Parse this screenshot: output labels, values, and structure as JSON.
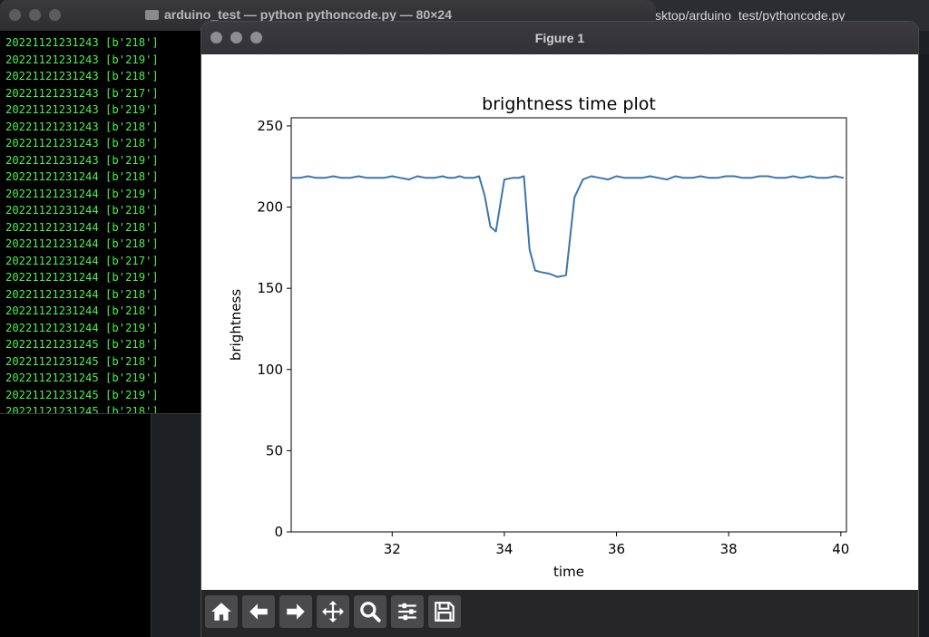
{
  "background_editor": {
    "path_text": "sktop/arduino_test/pythoncode.py"
  },
  "terminal": {
    "title": "arduino_test — python pythoncode.py — 80×24",
    "lines": [
      "20221121231243 [b'218']",
      "20221121231243 [b'219']",
      "20221121231243 [b'218']",
      "20221121231243 [b'217']",
      "20221121231243 [b'219']",
      "20221121231243 [b'218']",
      "20221121231243 [b'218']",
      "20221121231243 [b'219']",
      "20221121231244 [b'218']",
      "20221121231244 [b'219']",
      "20221121231244 [b'218']",
      "20221121231244 [b'218']",
      "20221121231244 [b'218']",
      "20221121231244 [b'217']",
      "20221121231244 [b'219']",
      "20221121231244 [b'218']",
      "20221121231244 [b'218']",
      "20221121231244 [b'219']",
      "20221121231245 [b'218']",
      "20221121231245 [b'218']",
      "20221121231245 [b'219']",
      "20221121231245 [b'219']",
      "20221121231245 [b'218']"
    ]
  },
  "figure": {
    "window_title": "Figure 1",
    "toolbar": [
      {
        "icon": "home-icon",
        "name": "home-button"
      },
      {
        "icon": "back-arrow-icon",
        "name": "back-button"
      },
      {
        "icon": "forward-arrow-icon",
        "name": "forward-button"
      },
      {
        "icon": "pan-move-icon",
        "name": "pan-button"
      },
      {
        "icon": "zoom-magnifier-icon",
        "name": "zoom-button"
      },
      {
        "icon": "configure-sliders-icon",
        "name": "configure-subplots-button"
      },
      {
        "icon": "save-floppy-icon",
        "name": "save-button"
      }
    ]
  },
  "chart_data": {
    "type": "line",
    "title": "brightness time plot",
    "xlabel": "time",
    "ylabel": "brightness",
    "xlim": [
      30.2,
      40.1
    ],
    "ylim": [
      0,
      255
    ],
    "xticks": [
      32,
      34,
      36,
      38,
      40
    ],
    "yticks": [
      0,
      50,
      100,
      150,
      200,
      250
    ],
    "grid": false,
    "line_color": "#3b75af",
    "series": [
      {
        "x": [
          30.2,
          30.35,
          30.5,
          30.65,
          30.8,
          30.95,
          31.1,
          31.25,
          31.4,
          31.55,
          31.7,
          31.85,
          32.0,
          32.15,
          32.3,
          32.45,
          32.6,
          32.75,
          32.9,
          33.0,
          33.1,
          33.2,
          33.3,
          33.45,
          33.55,
          33.65,
          33.75,
          33.85,
          34.0,
          34.15,
          34.25,
          34.35,
          34.45,
          34.55,
          34.65,
          34.8,
          34.95,
          35.1,
          35.25,
          35.4,
          35.55,
          35.7,
          35.85,
          36.0,
          36.15,
          36.3,
          36.45,
          36.6,
          36.75,
          36.9,
          37.05,
          37.2,
          37.35,
          37.5,
          37.65,
          37.8,
          37.95,
          38.1,
          38.25,
          38.4,
          38.55,
          38.7,
          38.85,
          39.0,
          39.15,
          39.3,
          39.45,
          39.6,
          39.75,
          39.9,
          40.05
        ],
        "y": [
          218,
          218,
          219,
          218,
          218,
          219,
          218,
          218,
          219,
          218,
          218,
          218,
          219,
          218,
          217,
          219,
          218,
          218,
          219,
          218,
          218,
          219,
          218,
          218,
          219,
          207,
          188,
          185,
          217,
          218,
          218,
          219,
          174,
          161,
          160,
          159,
          157,
          158,
          206,
          217,
          219,
          218,
          217,
          219,
          218,
          218,
          218,
          219,
          218,
          217,
          219,
          218,
          218,
          219,
          218,
          218,
          219,
          219,
          218,
          218,
          219,
          219,
          218,
          218,
          219,
          218,
          219,
          218,
          218,
          219,
          218
        ]
      }
    ]
  }
}
